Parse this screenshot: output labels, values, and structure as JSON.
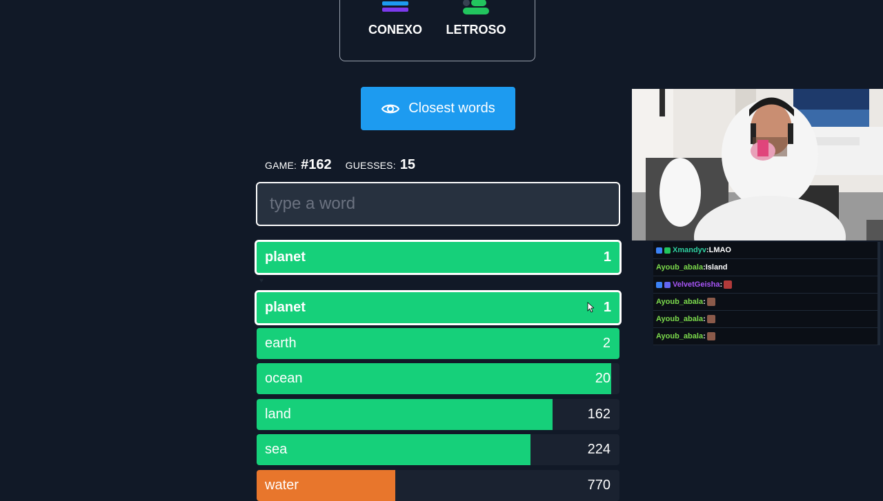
{
  "games": {
    "conexo": {
      "label": "CONEXO",
      "colors": [
        "#22c55e",
        "#1d9bf0",
        "#7c3aed"
      ]
    },
    "letroso": {
      "label": "LETROSO",
      "color": "#22c55e"
    }
  },
  "closest_button": {
    "label": "Closest words",
    "icon": "eye-icon"
  },
  "game_info": {
    "game_label": "GAME:",
    "game_value": "#162",
    "guesses_label": "GUESSES:",
    "guesses_value": "15"
  },
  "input": {
    "placeholder": "type a word",
    "value": ""
  },
  "last_guess": {
    "word": "planet",
    "rank": "1",
    "fill_fraction": 1.0,
    "color": "#16d07a"
  },
  "guesses": [
    {
      "word": "planet",
      "rank": "1",
      "fill_fraction": 1.0,
      "color": "#16d07a",
      "highlight": true
    },
    {
      "word": "earth",
      "rank": "2",
      "fill_fraction": 1.0,
      "color": "#16d07a",
      "highlight": false
    },
    {
      "word": "ocean",
      "rank": "20",
      "fill_fraction": 0.977,
      "color": "#16d07a",
      "highlight": false
    },
    {
      "word": "land",
      "rank": "162",
      "fill_fraction": 0.815,
      "color": "#16d07a",
      "highlight": false
    },
    {
      "word": "sea",
      "rank": "224",
      "fill_fraction": 0.755,
      "color": "#16d07a",
      "highlight": false
    },
    {
      "word": "water",
      "rank": "770",
      "fill_fraction": 0.383,
      "color": "#e8762c",
      "highlight": false
    }
  ],
  "chat": [
    {
      "user": "Xmandyv",
      "message": "LMAO",
      "user_color": "#2fd0a0",
      "badges": [
        "#3b82f6",
        "#22c55e"
      ],
      "emote": false
    },
    {
      "user": "Ayoub_abala",
      "message": "Island",
      "user_color": "#7ddc4c",
      "badges": [],
      "emote": false
    },
    {
      "user": "VelvetGeisha",
      "message": "",
      "user_color": "#a855f7",
      "badges": [
        "#3b82f6",
        "#6366f1"
      ],
      "emote": true,
      "emote_color": "#b23a3a"
    },
    {
      "user": "Ayoub_abala",
      "message": "",
      "user_color": "#7ddc4c",
      "badges": [],
      "emote": true,
      "emote_color": "#8b5a4a"
    },
    {
      "user": "Ayoub_abala",
      "message": "",
      "user_color": "#7ddc4c",
      "badges": [],
      "emote": true,
      "emote_color": "#8b5a4a"
    },
    {
      "user": "Ayoub_abala",
      "message": "",
      "user_color": "#7ddc4c",
      "badges": [],
      "emote": true,
      "emote_color": "#8b5a4a"
    }
  ]
}
